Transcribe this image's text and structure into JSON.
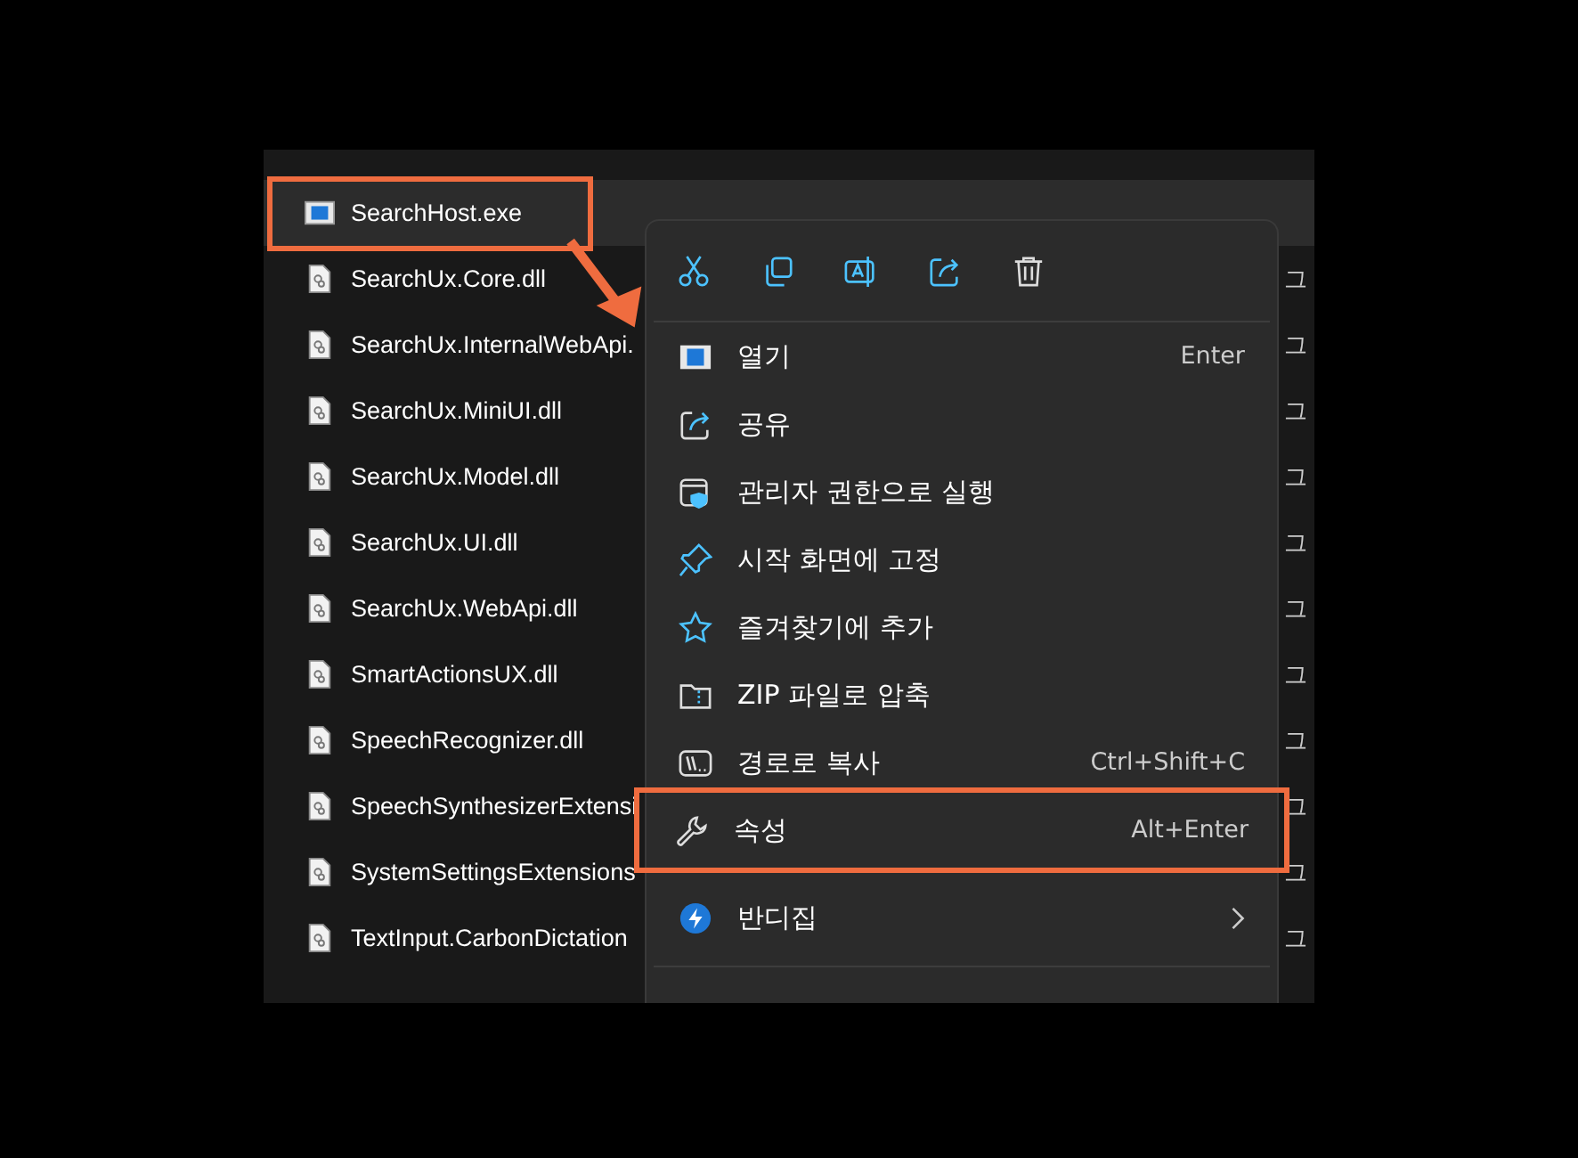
{
  "files": [
    {
      "name": "SearchHost.exe",
      "kind": "exe",
      "selected": true
    },
    {
      "name": "SearchUx.Core.dll",
      "kind": "dll",
      "selected": false,
      "type": "그"
    },
    {
      "name": "SearchUx.InternalWebApi.",
      "kind": "dll",
      "selected": false,
      "type": "그"
    },
    {
      "name": "SearchUx.MiniUI.dll",
      "kind": "dll",
      "selected": false,
      "type": "그"
    },
    {
      "name": "SearchUx.Model.dll",
      "kind": "dll",
      "selected": false,
      "type": "그"
    },
    {
      "name": "SearchUx.UI.dll",
      "kind": "dll",
      "selected": false,
      "type": "그"
    },
    {
      "name": "SearchUx.WebApi.dll",
      "kind": "dll",
      "selected": false,
      "type": "그"
    },
    {
      "name": "SmartActionsUX.dll",
      "kind": "dll",
      "selected": false,
      "type": "그"
    },
    {
      "name": "SpeechRecognizer.dll",
      "kind": "dll",
      "selected": false,
      "type": "그"
    },
    {
      "name": "SpeechSynthesizerExtensi",
      "kind": "dll",
      "selected": false,
      "type": "그"
    },
    {
      "name": "SystemSettingsExtensions",
      "kind": "dll",
      "selected": false,
      "type": "그"
    },
    {
      "name": "TextInput.CarbonDictation",
      "kind": "dll",
      "selected": false,
      "type": "그"
    }
  ],
  "context_menu": {
    "items": [
      {
        "label": "열기",
        "shortcut": "Enter",
        "kind": "item",
        "highlighted": false
      },
      {
        "label": "공유",
        "kind": "item",
        "highlighted": false
      },
      {
        "label": "관리자 권한으로 실행",
        "kind": "item",
        "highlighted": false
      },
      {
        "label": "시작 화면에 고정",
        "kind": "item",
        "highlighted": false
      },
      {
        "label": "즐겨찾기에 추가",
        "kind": "item",
        "highlighted": false
      },
      {
        "label": "ZIP 파일로 압축",
        "kind": "item",
        "highlighted": false
      },
      {
        "label": "경로로 복사",
        "shortcut": "Ctrl+Shift+C",
        "kind": "item",
        "highlighted": false
      },
      {
        "label": "속성",
        "shortcut": "Alt+Enter",
        "kind": "item",
        "highlighted": true
      },
      {
        "label": "반디집",
        "kind": "submenu",
        "highlighted": false
      }
    ]
  }
}
